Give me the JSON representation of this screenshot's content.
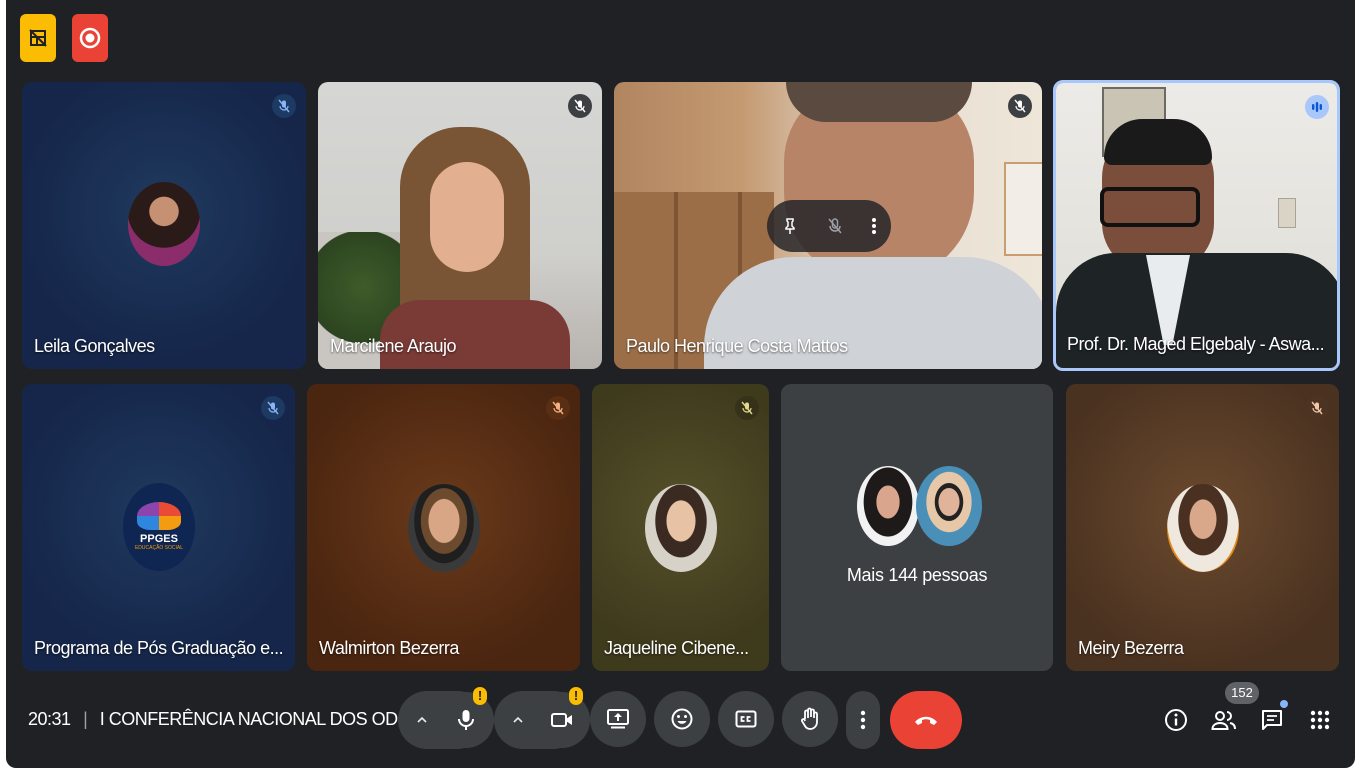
{
  "top_icons": [
    {
      "icon": "no-layout-icon",
      "color": "#fbbc04"
    },
    {
      "icon": "recording-icon",
      "color": "#ea4335"
    }
  ],
  "tiles": [
    {
      "name": "Leila Gonçalves",
      "mic": "muted"
    },
    {
      "name": "Marcilene Araujo",
      "mic": "muted"
    },
    {
      "name": "Paulo Henrique Costa Mattos",
      "mic": "muted"
    },
    {
      "name": "Prof. Dr. Maged Elgebaly - Aswa...",
      "mic": "speaking"
    },
    {
      "name": "Programa de Pós Graduação e...",
      "mic": "muted",
      "logo_text": "PPGES",
      "logo_subtext": "EDUCAÇÃO SOCIAL"
    },
    {
      "name": "Walmirton Bezerra",
      "mic": "muted"
    },
    {
      "name": "Jaqueline Cibene...",
      "mic": "muted"
    },
    {
      "label": "Mais 144 pessoas"
    },
    {
      "name": "Meiry Bezerra",
      "mic": "muted"
    }
  ],
  "overlay_controls": [
    "pin-icon",
    "mute-icon",
    "more-vert-icon"
  ],
  "bottom_bar": {
    "time": "20:31",
    "separator": "|",
    "meeting_title": "I CONFERÊNCIA NACIONAL DOS OD...",
    "warning_badge": "!",
    "participants_count": "152"
  },
  "colors": {
    "background": "#202124",
    "end_call": "#ea4335",
    "accent": "#8ab4f8",
    "warning": "#fbbc04"
  }
}
